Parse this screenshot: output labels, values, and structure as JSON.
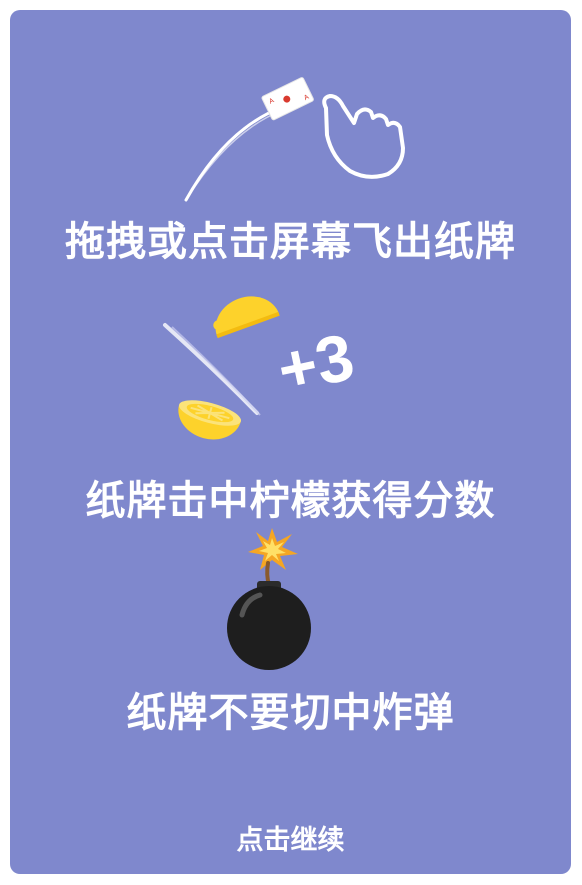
{
  "colors": {
    "panel_bg": "#7f88cd",
    "text": "#ffffff",
    "lemon": "#fdd22b",
    "bomb": "#1e1e1e"
  },
  "tutorial": {
    "step1_text": "拖拽或点击屏幕飞出纸牌",
    "step2_text": "纸牌击中柠檬获得分数",
    "score_bonus": "+3",
    "step3_text": "纸牌不要切中炸弹",
    "continue_label": "点击继续"
  },
  "icons": {
    "step1": "hand-swipe-card-icon",
    "step2": "sliced-lemon-icon",
    "step3": "bomb-icon"
  }
}
